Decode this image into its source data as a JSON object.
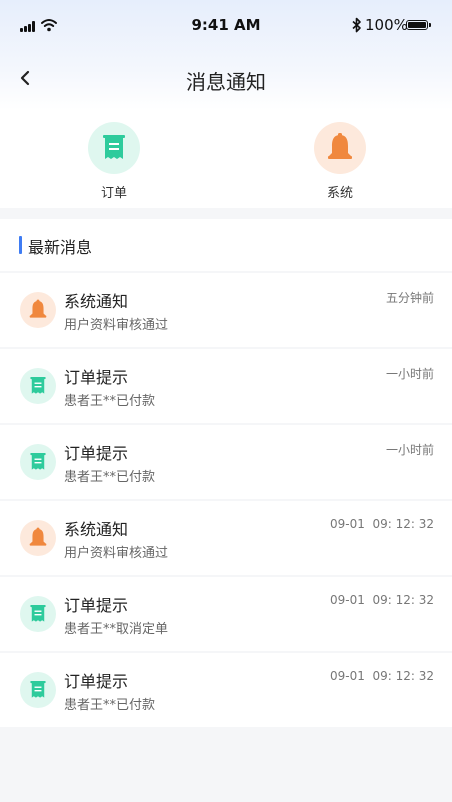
{
  "status_bar": {
    "time": "9:41 AM",
    "battery": "100%",
    "icons": [
      "signal-icon",
      "wifi-icon",
      "bluetooth-icon",
      "battery-icon"
    ]
  },
  "nav": {
    "title": "消息通知",
    "back_icon": "chevron-left-icon"
  },
  "categories": [
    {
      "label": "订单",
      "icon": "receipt-icon",
      "color": "#2ecb9c"
    },
    {
      "label": "系统",
      "icon": "bell-icon",
      "color": "#f0883e"
    }
  ],
  "section": {
    "title": "最新消息",
    "accent": "#3f7cf3"
  },
  "messages": [
    {
      "type": "system",
      "icon": "bell-icon",
      "title": "系统通知",
      "subtitle": "用户资料审核通过",
      "time": "五分钟前"
    },
    {
      "type": "order",
      "icon": "receipt-icon",
      "title": "订单提示",
      "subtitle": "患者王**已付款",
      "time": "一小时前"
    },
    {
      "type": "order",
      "icon": "receipt-icon",
      "title": "订单提示",
      "subtitle": "患者王**已付款",
      "time": "一小时前"
    },
    {
      "type": "system",
      "icon": "bell-icon",
      "title": "系统通知",
      "subtitle": "用户资料审核通过",
      "time": "09-01  09: 12: 32"
    },
    {
      "type": "order",
      "icon": "receipt-icon",
      "title": "订单提示",
      "subtitle": "患者王**取消定单",
      "time": "09-01  09: 12: 32"
    },
    {
      "type": "order",
      "icon": "receipt-icon",
      "title": "订单提示",
      "subtitle": "患者王**已付款",
      "time": "09-01  09: 12: 32"
    }
  ]
}
